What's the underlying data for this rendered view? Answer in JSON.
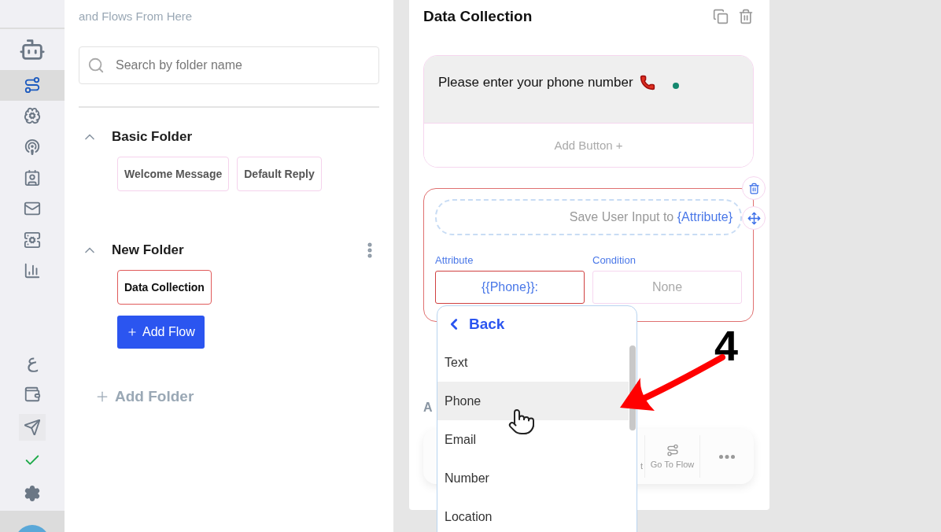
{
  "sidebar": {
    "items": [
      {
        "selected": false
      },
      {
        "selected": true
      },
      {
        "selected": false
      },
      {
        "selected": false
      },
      {
        "selected": false
      },
      {
        "selected": false
      },
      {
        "selected": false
      },
      {
        "selected": false
      }
    ],
    "bottom_items": [
      {
        "kind": "glyph",
        "glyph": "ع"
      },
      {
        "kind": "icon"
      },
      {
        "kind": "icon"
      },
      {
        "kind": "icon"
      },
      {
        "kind": "icon"
      }
    ]
  },
  "folders_panel": {
    "description": "and Flows From Here",
    "search": {
      "placeholder": "Search by folder name"
    },
    "folders": [
      {
        "name": "Basic Folder",
        "expanded": true,
        "has_menu": false,
        "flows": [
          {
            "label": "Welcome Message",
            "selected": false
          },
          {
            "label": "Default Reply",
            "selected": false
          }
        ]
      },
      {
        "name": "New Folder",
        "expanded": true,
        "has_menu": true,
        "flows": [
          {
            "label": "Data Collection",
            "selected": true
          }
        ],
        "add_flow": "Add Flow"
      }
    ],
    "add_folder": "Add Folder"
  },
  "flow_card": {
    "title": "Data Collection",
    "message": {
      "text": "Please enter your phone number",
      "add_button": "Add Button +"
    },
    "input_block": {
      "prompt": "Save User Input to ",
      "prompt_token": "{Attribute}",
      "attribute": {
        "label": "Attribute",
        "value": "{{Phone}}:"
      },
      "condition": {
        "label": "Condition",
        "value": "None"
      }
    },
    "section_label": "A",
    "toolbar": [
      {
        "kind": "cut",
        "label": "t"
      },
      {
        "kind": "action",
        "label": "Go To Flow"
      },
      {
        "kind": "more"
      }
    ]
  },
  "dropdown": {
    "back": "Back",
    "items": [
      {
        "label": "Text",
        "selected": false
      },
      {
        "label": "Phone",
        "selected": true
      },
      {
        "label": "Email",
        "selected": false
      },
      {
        "label": "Number",
        "selected": false
      },
      {
        "label": "Location",
        "selected": false
      }
    ]
  },
  "annotation": {
    "label": "4"
  }
}
